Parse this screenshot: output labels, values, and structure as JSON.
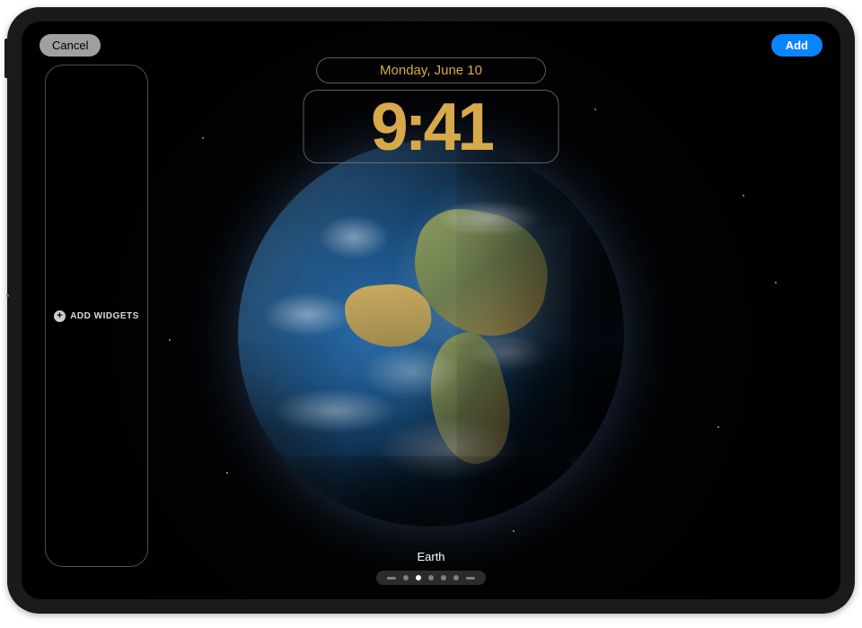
{
  "topbar": {
    "cancel_label": "Cancel",
    "add_label": "Add"
  },
  "lockscreen": {
    "date": "Monday, June 10",
    "time": "9:41",
    "wallpaper_name": "Earth"
  },
  "widgets": {
    "add_label": "ADD WIDGETS"
  },
  "pagination": {
    "total": 7,
    "active_index": 2
  },
  "colors": {
    "clock_tint": "#d8a94a",
    "accent": "#0a84ff"
  }
}
